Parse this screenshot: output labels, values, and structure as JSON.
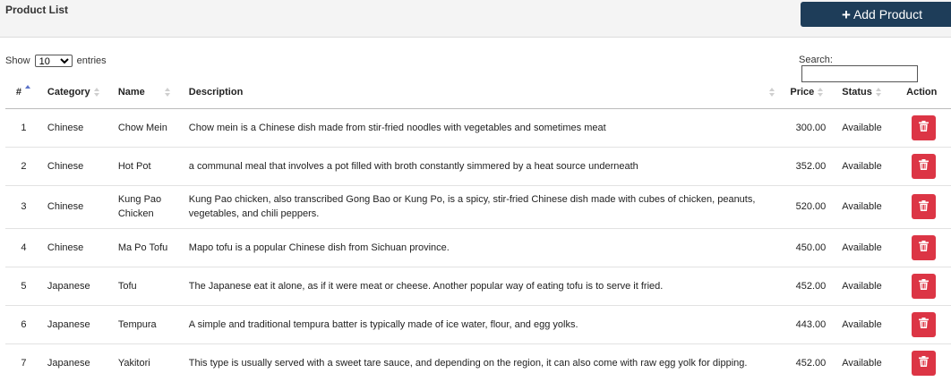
{
  "header": {
    "title": "Product List",
    "add_button_label": "Add Product"
  },
  "controls": {
    "show_label": "Show",
    "entries_value": "10",
    "entries_label": "entries",
    "search_label": "Search:",
    "search_value": ""
  },
  "table": {
    "columns": {
      "num": "#",
      "category": "Category",
      "name": "Name",
      "description": "Description",
      "price": "Price",
      "status": "Status",
      "action": "Action"
    },
    "rows": [
      {
        "num": "1",
        "category": "Chinese",
        "name": "Chow Mein",
        "description": "Chow mein is a Chinese dish made from stir-fried noodles with vegetables and sometimes meat",
        "price": "300.00",
        "status": "Available"
      },
      {
        "num": "2",
        "category": "Chinese",
        "name": "Hot Pot",
        "description": "a communal meal that involves a pot filled with broth constantly simmered by a heat source underneath",
        "price": "352.00",
        "status": "Available"
      },
      {
        "num": "3",
        "category": "Chinese",
        "name": "Kung Pao Chicken",
        "description": "Kung Pao chicken, also transcribed Gong Bao or Kung Po, is a spicy, stir-fried Chinese dish made with cubes of chicken, peanuts, vegetables, and chili peppers.",
        "price": "520.00",
        "status": "Available"
      },
      {
        "num": "4",
        "category": "Chinese",
        "name": "Ma Po Tofu",
        "description": "Mapo tofu is a popular Chinese dish from Sichuan province.",
        "price": "450.00",
        "status": "Available"
      },
      {
        "num": "5",
        "category": "Japanese",
        "name": "Tofu",
        "description": "The Japanese eat it alone, as if it were meat or cheese. Another popular way of eating tofu is to serve it fried.",
        "price": "452.00",
        "status": "Available"
      },
      {
        "num": "6",
        "category": "Japanese",
        "name": "Tempura",
        "description": "A simple and traditional tempura batter is typically made of ice water, flour, and egg yolks.",
        "price": "443.00",
        "status": "Available"
      },
      {
        "num": "7",
        "category": "Japanese",
        "name": "Yakitori",
        "description": "This type is usually served with a sweet tare sauce, and depending on the region, it can also come with raw egg yolk for dipping.",
        "price": "452.00",
        "status": "Available"
      }
    ]
  },
  "icons": {
    "add": "plus-icon",
    "delete": "trash-icon"
  },
  "colors": {
    "header_button": "#1e3d59",
    "delete_button": "#dc3545",
    "sort_active": "#5b73c8"
  }
}
